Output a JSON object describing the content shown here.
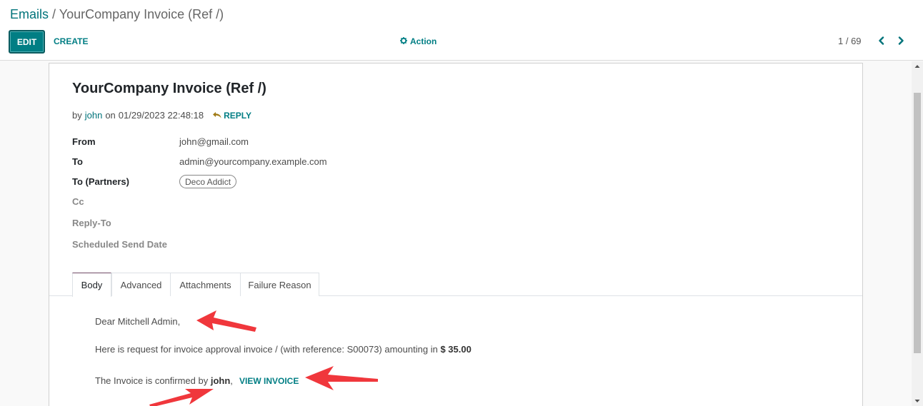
{
  "breadcrumb": {
    "parent": "Emails",
    "separator": "/",
    "current": "YourCompany Invoice (Ref /)"
  },
  "toolbar": {
    "edit_label": "EDIT",
    "create_label": "CREATE",
    "action_label": "Action",
    "action_icon": "gear-icon"
  },
  "pager": {
    "value": "1 / 69",
    "prev_icon": "chevron-left-icon",
    "next_icon": "chevron-right-icon"
  },
  "message": {
    "title": "YourCompany Invoice (Ref /)",
    "by_label": "by",
    "author": "john",
    "on_label": "on",
    "date": "01/29/2023 22:48:18",
    "reply_label": "REPLY",
    "reply_icon": "reply-icon"
  },
  "fields": {
    "from_label": "From",
    "from_value": "john@gmail.com",
    "to_label": "To",
    "to_value": "admin@yourcompany.example.com",
    "partners_label": "To (Partners)",
    "partners_tag": "Deco Addict",
    "cc_label": "Cc",
    "reply_to_label": "Reply-To",
    "scheduled_label": "Scheduled Send Date"
  },
  "tabs": [
    {
      "label": "Body",
      "active": true
    },
    {
      "label": "Advanced",
      "active": false
    },
    {
      "label": "Attachments",
      "active": false
    },
    {
      "label": "Failure Reason",
      "active": false
    }
  ],
  "body": {
    "greeting": "Dear Mitchell Admin,",
    "line1_prefix": "Here is request for invoice approval invoice / (with reference: S00073) amounting in",
    "amount": "$ 35.00",
    "line2_prefix": "The Invoice is confirmed by",
    "confirmed_by": "john",
    "line2_suffix": ",",
    "view_invoice_label": "VIEW INVOICE"
  },
  "colors": {
    "accent": "#017e84",
    "link": "#00737a",
    "annotation_arrow": "#f0373c",
    "tab_active_border": "#714b67"
  }
}
